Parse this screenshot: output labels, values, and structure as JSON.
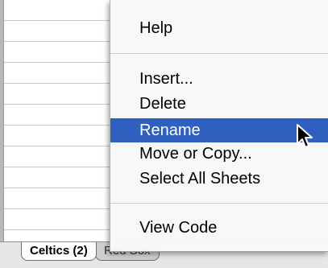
{
  "menu": {
    "items": [
      {
        "label": "Help"
      },
      {
        "label": "Insert..."
      },
      {
        "label": "Delete"
      },
      {
        "label": "Rename",
        "highlighted": true
      },
      {
        "label": "Move or Copy..."
      },
      {
        "label": "Select All Sheets"
      },
      {
        "label": "View Code"
      }
    ]
  },
  "sheet_tabs": [
    {
      "label": "Celtics (2)",
      "active": true
    },
    {
      "label": "Red Sox",
      "active": false
    }
  ],
  "colors": {
    "highlight": "#2f5fbf"
  },
  "icons": [
    "arrow-pointer-icon"
  ]
}
